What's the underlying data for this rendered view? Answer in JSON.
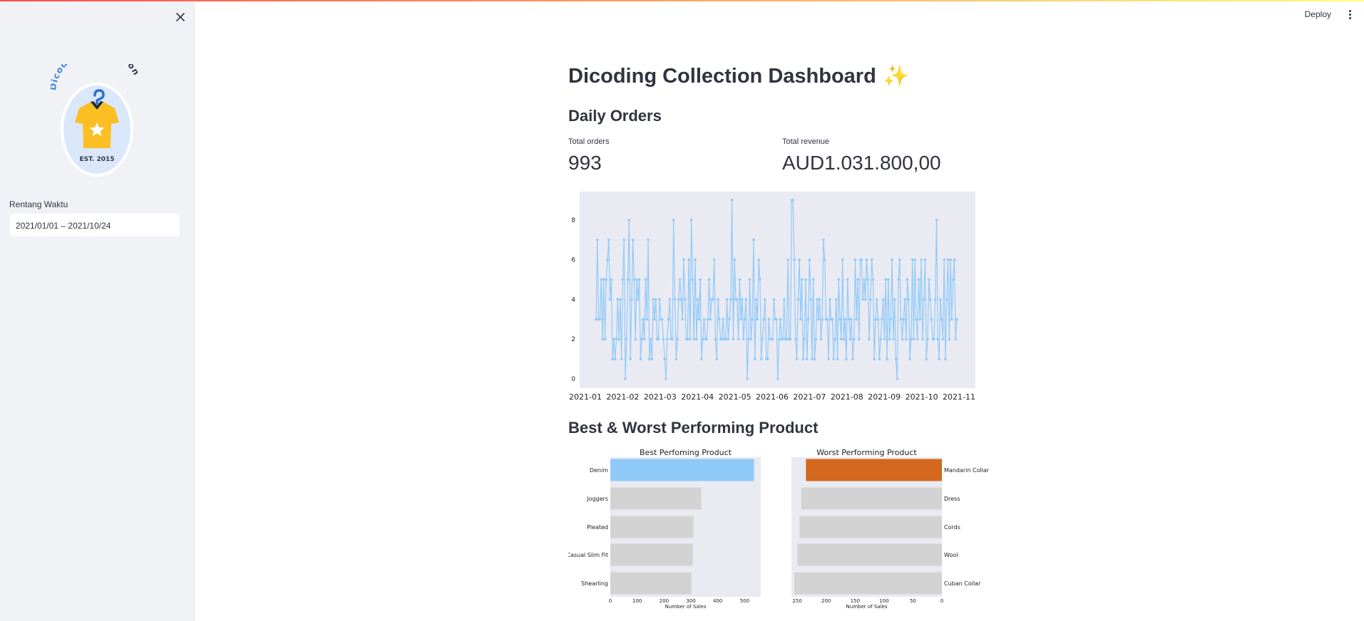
{
  "sidebar": {
    "logo": {
      "arc_text_blue": "Dicoding",
      "arc_text_dark": "Collection",
      "est_text": "EST. 2015"
    },
    "date_range": {
      "label": "Rentang Waktu",
      "value": "2021/01/01 – 2021/10/24"
    }
  },
  "header": {
    "deploy_label": "Deploy"
  },
  "main": {
    "title": "Dicoding Collection Dashboard",
    "title_emoji": "✨",
    "daily_orders": {
      "heading": "Daily Orders",
      "metrics": [
        {
          "label": "Total orders",
          "value": "993"
        },
        {
          "label": "Total revenue",
          "value": "AUD1.031.800,00"
        }
      ]
    },
    "best_worst": {
      "heading": "Best & Worst Performing Product"
    }
  },
  "colors": {
    "line": "#90caf9",
    "best_bar": "#90caf9",
    "worst_bar": "#d2691e",
    "other_bar": "#d3d3d3",
    "plot_bg": "#eaeaf2"
  },
  "chart_data": [
    {
      "type": "line",
      "ylim": [
        0,
        9
      ],
      "yticks": [
        0,
        2,
        4,
        6,
        8
      ],
      "xticks": [
        "2021-01",
        "2021-02",
        "2021-03",
        "2021-04",
        "2021-05",
        "2021-06",
        "2021-07",
        "2021-08",
        "2021-09",
        "2021-10",
        "2021-11"
      ],
      "x_start": "2021-01-06",
      "x_end": "2021-10-24",
      "series": [
        {
          "values": [
            3,
            7,
            3,
            3,
            5,
            2,
            5,
            2,
            5,
            6,
            7,
            4,
            5,
            1,
            2,
            1,
            2,
            4,
            2,
            4,
            1,
            5,
            7,
            0,
            2,
            5,
            8,
            1,
            4,
            7,
            5,
            2,
            5,
            4,
            5,
            1,
            2,
            3,
            2,
            5,
            3,
            7,
            1,
            2,
            1,
            4,
            3,
            4,
            2,
            2,
            4,
            3,
            3,
            2,
            1,
            0,
            2,
            3,
            4,
            2,
            2,
            8,
            4,
            1,
            2,
            4,
            5,
            4,
            3,
            6,
            4,
            2,
            2,
            6,
            2,
            8,
            5,
            2,
            6,
            2,
            4,
            3,
            5,
            1,
            2,
            3,
            2,
            2,
            3,
            5,
            3,
            4,
            4,
            6,
            2,
            1,
            4,
            3,
            2,
            2,
            3,
            2,
            2,
            4,
            2,
            3,
            4,
            9,
            2,
            6,
            4,
            4,
            2,
            5,
            3,
            4,
            2,
            3,
            4,
            0,
            2,
            5,
            2,
            3,
            7,
            1,
            4,
            3,
            6,
            5,
            1,
            2,
            3,
            4,
            1,
            1,
            3,
            2,
            2,
            2,
            4,
            3,
            3,
            0,
            2,
            3,
            2,
            2,
            4,
            2,
            2,
            6,
            2,
            2,
            9,
            9,
            6,
            2,
            1,
            4,
            6,
            3,
            5,
            1,
            2,
            5,
            1,
            3,
            6,
            4,
            1,
            5,
            1,
            2,
            4,
            3,
            4,
            2,
            3,
            7,
            6,
            3,
            3,
            1,
            4,
            3,
            3,
            1,
            2,
            4,
            1,
            5,
            3,
            2,
            6,
            2,
            3,
            1,
            5,
            3,
            2,
            3,
            1,
            2,
            6,
            3,
            5,
            2,
            6,
            6,
            4,
            5,
            4,
            6,
            5,
            2,
            4,
            6,
            5,
            1,
            3,
            4,
            3,
            1,
            2,
            3,
            4,
            2,
            5,
            1,
            5,
            2,
            3,
            6,
            2,
            4,
            1,
            0,
            5,
            6,
            3,
            2,
            3,
            4,
            2,
            5,
            4,
            1,
            2,
            6,
            2,
            6,
            3,
            2,
            5,
            3,
            6,
            2,
            4,
            6,
            1,
            2,
            5,
            4,
            3,
            2,
            2,
            4,
            8,
            2,
            1,
            4,
            3,
            2,
            6,
            1,
            4,
            6,
            2,
            6,
            3,
            5,
            6,
            2,
            3
          ],
          "color": "#90caf9"
        }
      ]
    },
    {
      "type": "bar",
      "orientation": "horizontal",
      "title": "Best Perfoming Product",
      "xlabel": "Number of Sales",
      "categories": [
        "Denim",
        "Joggers",
        "Pleated",
        "Casual Slim Fit",
        "Shearling"
      ],
      "values": [
        535,
        338,
        310,
        307,
        302
      ],
      "xlim": [
        0,
        560
      ],
      "xticks": [
        0,
        100,
        200,
        300,
        400,
        500
      ]
    },
    {
      "type": "bar",
      "orientation": "horizontal",
      "direction": "reversed",
      "title": "Worst Performing Product",
      "xlabel": "Number of Sales",
      "categories": [
        "Mandarin Collar",
        "Dress",
        "Cords",
        "Wool",
        "Cuban Collar"
      ],
      "values": [
        235,
        243,
        246,
        250,
        255
      ],
      "xlim": [
        260,
        0
      ],
      "xticks": [
        250,
        200,
        150,
        100,
        50,
        0
      ]
    }
  ]
}
